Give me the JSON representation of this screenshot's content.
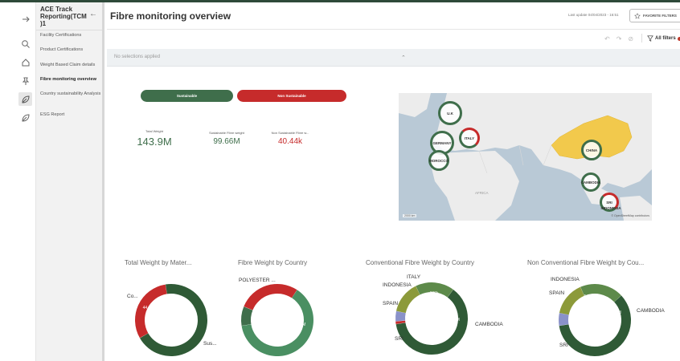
{
  "app": {
    "title": "ACE Track Reporting(TCM )1",
    "page_title": "Fibre monitoring overview",
    "last_update": "Last update 04/04/2023 - 16:51",
    "favorite_filters": "FAVORITE FILTERS",
    "all_filters": "All filters"
  },
  "rail": {
    "icons": [
      "arrow-right-icon",
      "search-icon",
      "home-icon",
      "pin-icon",
      "leaf-icon",
      "leaf-icon"
    ]
  },
  "nav": {
    "items": [
      {
        "label": "Facility Certifications"
      },
      {
        "label": "Product Certifications"
      },
      {
        "label": "Weight Based Claim details"
      },
      {
        "label": "Fibre monitoring overview"
      },
      {
        "label": "Country sustainability Analysis"
      },
      {
        "label": "ESG Report"
      }
    ]
  },
  "selections": {
    "text": "No selections applied"
  },
  "buttons": {
    "sustainable": "Sustainable",
    "non_sustainable": "Non Sustainable"
  },
  "kpis": [
    {
      "label": "Total Weight",
      "value": "143.9M",
      "color": "#3f6e4b"
    },
    {
      "label": "Sustainable Fibre weight",
      "value": "99.66M",
      "color": "#3f6e4b"
    },
    {
      "label": "Non Sustainable Fibre w...",
      "value": "40.44k",
      "color": "#c62b2b"
    }
  ],
  "map": {
    "markers": [
      "U.K",
      "GERMANY",
      "ITALY",
      "MOROCCO",
      "CHINA",
      "CAMBODIA",
      "SRI",
      "INDONESIA"
    ],
    "region_label": "AFRICA",
    "scale": "2000 km",
    "attribution": "© OpenStreetMap contributors"
  },
  "chart_data": [
    {
      "type": "pie",
      "title": "Total Weight by Mater...",
      "labels": [
        "Co...",
        "Sus..."
      ],
      "values": [
        44.25,
        99.66
      ],
      "value_labels": [
        "44.25M",
        "99.66M"
      ],
      "colors": [
        "#c62b2b",
        "#2f5a36"
      ]
    },
    {
      "type": "pie",
      "title": "Fibre Weight by Country",
      "labels": [
        "POLYESTER ..."
      ],
      "values": [
        13.65,
        44.25,
        99.65
      ],
      "value_labels": [
        "13.65M",
        "44.25M",
        "99.65M"
      ],
      "colors": [
        "#3f6e4b",
        "#c62b2b",
        "#4a8f62"
      ]
    },
    {
      "type": "pie",
      "title": "Conventional Fibre Weight by Country",
      "labels": [
        "ITALY",
        "INDONESIA",
        "SPAIN",
        "SRI",
        "CAMBODIA"
      ],
      "values": [
        0.306,
        1.1,
        3.48,
        4.2,
        15
      ],
      "value_labels": [
        "306k",
        "1.1M",
        "3.48M",
        "4.2M",
        "15M"
      ],
      "colors": [
        "#c62b2b",
        "#8a92c9",
        "#8c9a3a",
        "#5d8a4a",
        "#2f5a36"
      ]
    },
    {
      "type": "pie",
      "title": "Non Conventional Fibre Weight by Cou...",
      "labels": [
        "INDONESIA",
        "SPAIN",
        "SRI",
        "CAMBODIA"
      ],
      "values": [
        5.2,
        13.9,
        17.8,
        54
      ],
      "value_labels": [
        "5.2M",
        "13.9M",
        "17.8M",
        "54M"
      ],
      "colors": [
        "#8a92c9",
        "#8c9a3a",
        "#5d8a4a",
        "#2f5a36"
      ]
    }
  ]
}
